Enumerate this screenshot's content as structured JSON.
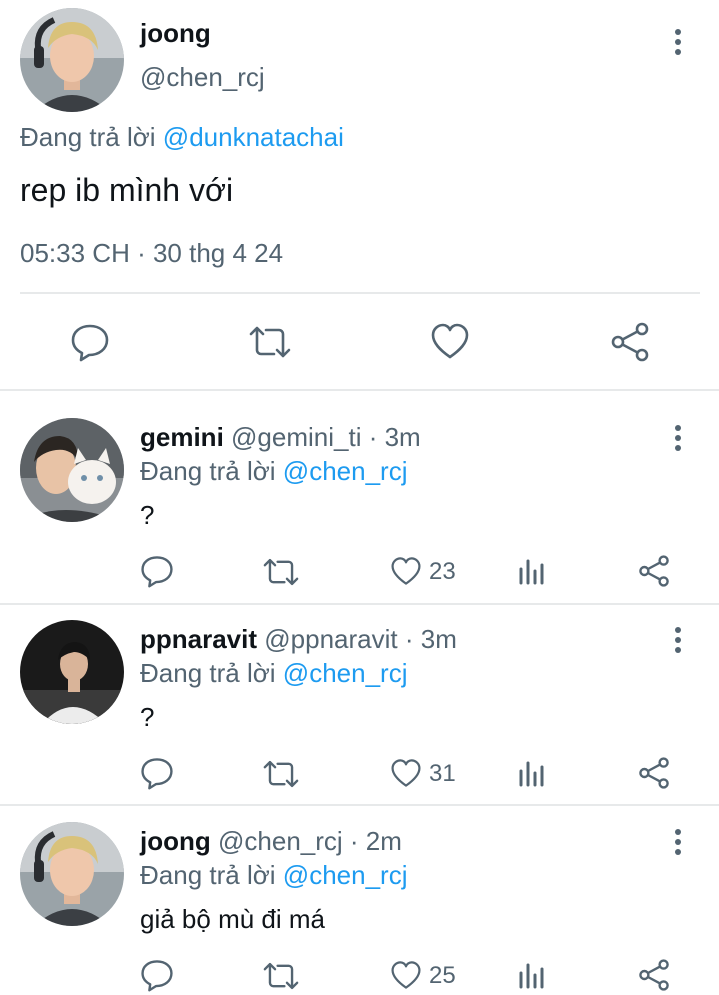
{
  "main_tweet": {
    "display_name": "joong",
    "handle": "@chen_rcj",
    "reply_prefix": "Đang trả lời",
    "reply_to": "@dunknatachai",
    "text": "rep ib mình với",
    "timestamp": "05:33 CH · 30 thg 4 24",
    "actions": [
      "reply-icon",
      "retweet-icon",
      "like-icon",
      "share-icon"
    ]
  },
  "replies": [
    {
      "display_name": "gemini",
      "handle": "@gemini_ti",
      "time": "· 3m",
      "reply_prefix": "Đang trả lời",
      "reply_to": "@chen_rcj",
      "text": "?",
      "likes": "23"
    },
    {
      "display_name": "ppnaravit",
      "handle": "@ppnaravit",
      "time": "· 3m",
      "reply_prefix": "Đang trả lời",
      "reply_to": "@chen_rcj",
      "text": "?",
      "likes": "31"
    },
    {
      "display_name": "joong",
      "handle": "@chen_rcj",
      "time": "· 2m",
      "reply_prefix": "Đang trả lời",
      "reply_to": "@chen_rcj",
      "text": "giả bộ mù đi má",
      "likes": "25"
    }
  ],
  "colors": {
    "link": "#1d9bf0",
    "secondary_text": "#536471",
    "divider": "#e7e9ea"
  }
}
